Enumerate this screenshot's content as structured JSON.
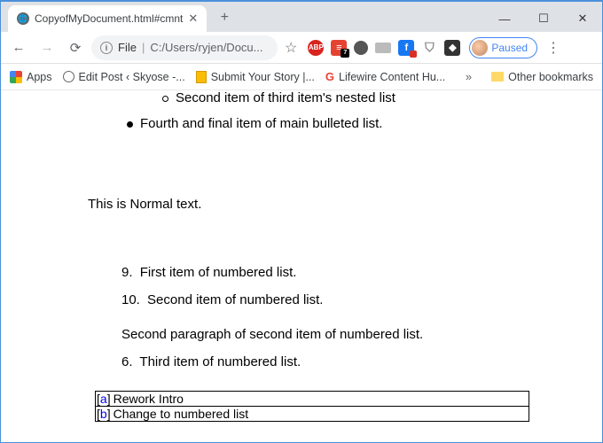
{
  "window": {
    "tab_title": "CopyofMyDocument.html#cmnt",
    "controls": {
      "min": "—",
      "max": "☐",
      "close": "✕"
    },
    "newtab": "+"
  },
  "toolbar": {
    "back": "←",
    "forward": "→",
    "reload": "⟳",
    "omni_info": "i",
    "omni_scheme": "File",
    "omni_path": "C:/Users/ryjen/Docu...",
    "star": "☆",
    "profile_status": "Paused",
    "menu": "⋮",
    "ext": {
      "abp": "ABP",
      "todoist_badge": "7",
      "fb": "f",
      "shield": "⛉",
      "bw": "◆"
    }
  },
  "bookmarks": {
    "apps": "Apps",
    "items": [
      "Edit Post ‹ Skyose -...",
      "Submit Your Story |...",
      "Lifewire Content Hu..."
    ],
    "chevron": "»",
    "other": "Other bookmarks"
  },
  "doc": {
    "nested_second": "Second item of third item's nested list",
    "fourth_item": "Fourth and final item of main bulleted list.",
    "normal": "This is Normal text.",
    "num_items": [
      {
        "n": "9.",
        "text": "First item of numbered list."
      },
      {
        "n": "10.",
        "text": "Second item of numbered list."
      }
    ],
    "second_para": "Second paragraph of second item of numbered list.",
    "third_num": {
      "n": "6.",
      "text": "Third item of numbered list."
    },
    "comments": [
      {
        "ref": "[a]",
        "text": "Rework Intro"
      },
      {
        "ref": "[b]",
        "text": "Change to numbered list"
      }
    ]
  }
}
